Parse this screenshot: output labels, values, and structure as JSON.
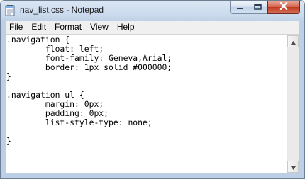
{
  "window": {
    "title": "nav_list.css - Notepad"
  },
  "menu": {
    "items": [
      "File",
      "Edit",
      "Format",
      "View",
      "Help"
    ]
  },
  "editor": {
    "lines": [
      ".navigation {",
      "        float: left;",
      "        font-family: Geneva,Arial;",
      "        border: 1px solid #000000;",
      "}",
      "",
      ".navigation ul {",
      "        margin: 0px;",
      "        padding: 0px;",
      "        list-style-type: none;",
      "",
      "}"
    ]
  },
  "icons": {
    "app": "notepad-icon",
    "minimize": "minimize-icon",
    "maximize": "maximize-icon",
    "close": "close-icon",
    "scroll_up": "scroll-up-arrow-icon",
    "scroll_down": "scroll-down-arrow-icon"
  },
  "colors": {
    "close_button": "#c2391f",
    "title_bar": "#c9d9ec"
  }
}
